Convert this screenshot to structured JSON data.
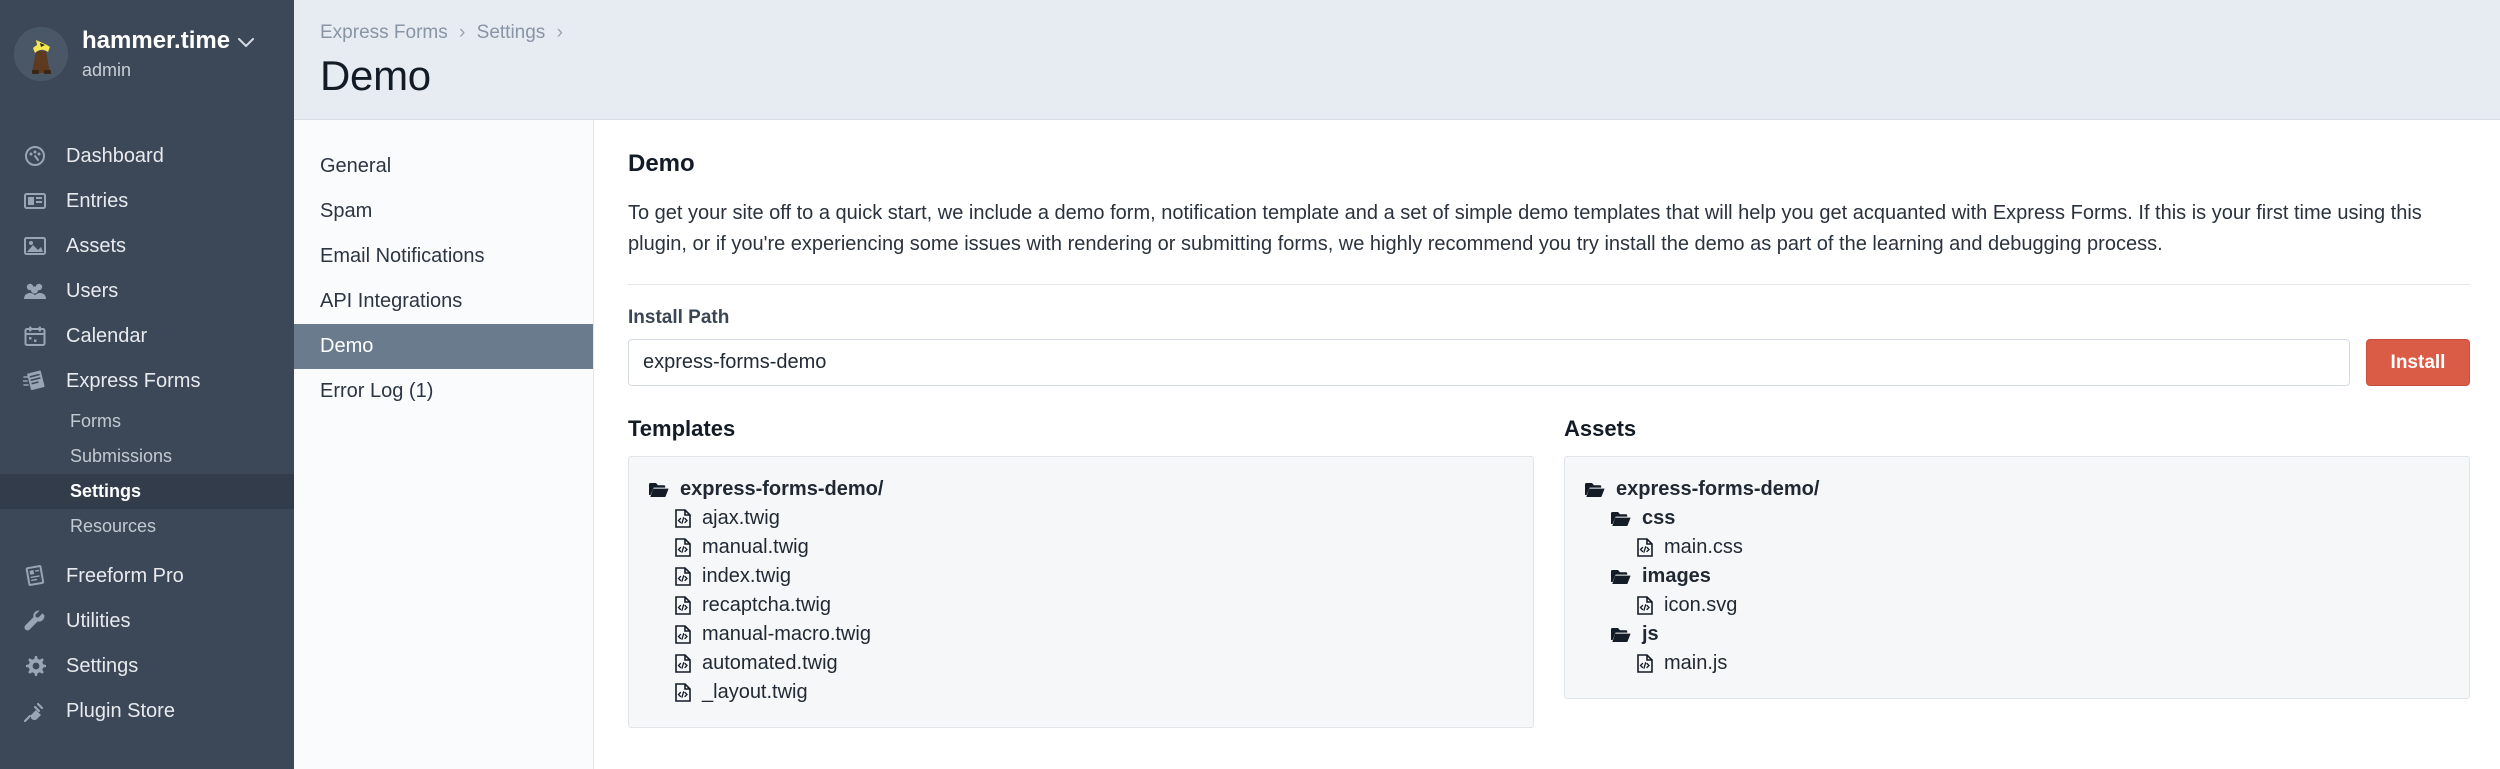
{
  "sidebar": {
    "account": {
      "name": "hammer.time",
      "role": "admin",
      "chevron": "chevron-down-icon",
      "avatar": "user-avatar"
    },
    "items": [
      {
        "label": "Dashboard",
        "icon": "dashboard-icon",
        "type": "main"
      },
      {
        "label": "Entries",
        "icon": "entries-icon",
        "type": "main"
      },
      {
        "label": "Assets",
        "icon": "assets-image-icon",
        "type": "main"
      },
      {
        "label": "Users",
        "icon": "users-icon",
        "type": "main"
      },
      {
        "label": "Calendar",
        "icon": "calendar-icon",
        "type": "main"
      },
      {
        "label": "Express Forms",
        "icon": "express-forms-icon",
        "type": "main"
      },
      {
        "label": "Forms",
        "type": "sub",
        "active": false
      },
      {
        "label": "Submissions",
        "type": "sub",
        "active": false
      },
      {
        "label": "Settings",
        "type": "sub",
        "active": true
      },
      {
        "label": "Resources",
        "type": "sub",
        "active": false
      },
      {
        "label": "Freeform Pro",
        "icon": "freeform-pro-icon",
        "type": "main"
      },
      {
        "label": "Utilities",
        "icon": "wrench-icon",
        "type": "main"
      },
      {
        "label": "Settings",
        "icon": "gear-icon",
        "type": "main"
      },
      {
        "label": "Plugin Store",
        "icon": "plug-icon",
        "type": "main"
      }
    ]
  },
  "header": {
    "breadcrumb": [
      "Express Forms",
      "Settings"
    ],
    "separator": "›",
    "title": "Demo"
  },
  "subnav": {
    "items": [
      {
        "label": "General",
        "active": false
      },
      {
        "label": "Spam",
        "active": false
      },
      {
        "label": "Email Notifications",
        "active": false
      },
      {
        "label": "API Integrations",
        "active": false
      },
      {
        "label": "Demo",
        "active": true
      },
      {
        "label": "Error Log (1)",
        "active": false
      }
    ]
  },
  "content": {
    "title": "Demo",
    "description": "To get your site off to a quick start, we include a demo form, notification template and a set of simple demo templates that will help you get acquanted with Express Forms. If this is your first time using this plugin, or if you're experiencing some issues with rendering or submitting forms, we highly recommend you try install the demo as part of the learning and debugging process.",
    "install_path_label": "Install Path",
    "install_path_value": "express-forms-demo",
    "install_path_placeholder": "express-forms-demo",
    "install_button": "Install",
    "templates": {
      "title": "Templates",
      "root": "express-forms-demo/",
      "files": [
        "ajax.twig",
        "manual.twig",
        "index.twig",
        "recaptcha.twig",
        "manual-macro.twig",
        "automated.twig",
        "_layout.twig"
      ]
    },
    "assets": {
      "title": "Assets",
      "root": "express-forms-demo/",
      "folders": [
        {
          "name": "css",
          "files": [
            "main.css"
          ]
        },
        {
          "name": "images",
          "files": [
            "icon.svg"
          ]
        },
        {
          "name": "js",
          "files": [
            "main.js"
          ]
        }
      ]
    }
  },
  "colors": {
    "sidebar_bg": "#3c4858",
    "sidebar_active": "#323c4a",
    "header_bg": "#e6ecf2",
    "subnav_active": "#6b7b8e",
    "install_button": "#da5b46",
    "tree_box_bg": "#f6f7f8"
  }
}
